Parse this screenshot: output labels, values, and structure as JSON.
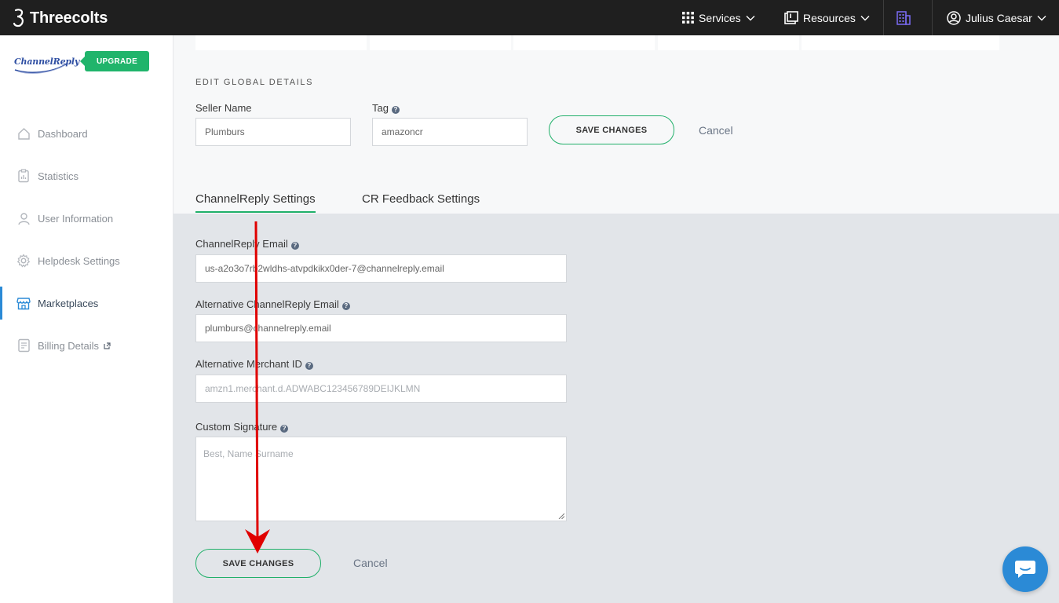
{
  "topbar": {
    "brand": "Threecolts",
    "services": "Services",
    "resources": "Resources",
    "user": "Julius Caesar"
  },
  "sidebar": {
    "logo_text": "ChannelReply",
    "upgrade": "UPGRADE",
    "items": [
      {
        "label": "Dashboard",
        "icon": "home-icon"
      },
      {
        "label": "Statistics",
        "icon": "clipboard-chart-icon"
      },
      {
        "label": "User Information",
        "icon": "user-icon"
      },
      {
        "label": "Helpdesk Settings",
        "icon": "gear-icon"
      },
      {
        "label": "Marketplaces",
        "icon": "store-icon",
        "active": true
      },
      {
        "label": "Billing Details",
        "icon": "billing-icon",
        "external": true
      }
    ]
  },
  "global": {
    "title": "EDIT GLOBAL DETAILS",
    "seller_name_label": "Seller Name",
    "seller_name_value": "Plumburs",
    "tag_label": "Tag",
    "tag_value": "amazoncr",
    "save": "SAVE CHANGES",
    "cancel": "Cancel"
  },
  "tabs": [
    {
      "label": "ChannelReply Settings",
      "active": true
    },
    {
      "label": "CR Feedback Settings",
      "active": false
    }
  ],
  "settings": {
    "email_label": "ChannelReply Email",
    "email_value": "us-a2o3o7rb2wldhs-atvpdkikx0der-7@channelreply.email",
    "alt_email_label": "Alternative ChannelReply Email",
    "alt_email_value": "plumburs@channelreply.email",
    "merchant_label": "Alternative Merchant ID",
    "merchant_placeholder": "amzn1.merchant.d.ADWABC123456789DEIJKLMN",
    "signature_label": "Custom Signature",
    "signature_placeholder": "Best, Name Surname",
    "save": "SAVE CHANGES",
    "cancel": "Cancel"
  },
  "colors": {
    "accent_green": "#21b06a",
    "brand_blue": "#2b8ad6",
    "annotation_red": "#e00000"
  }
}
